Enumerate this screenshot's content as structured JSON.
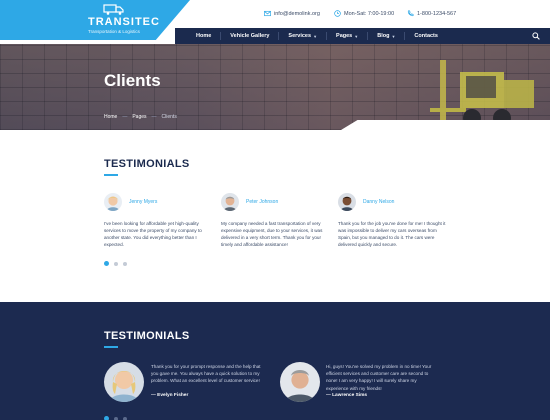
{
  "brand": {
    "name": "TRANSITEC",
    "tagline": "Transportation & Logistics",
    "accent": "#2ea8e6",
    "navy": "#1b2a4e"
  },
  "contacts": {
    "email": "info@demolink.org",
    "hours": "Mon-Sat: 7:00-19:00",
    "phone": "1-800-1234-567"
  },
  "nav": {
    "items": [
      {
        "label": "Home",
        "has_dropdown": false
      },
      {
        "label": "Vehicle Gallery",
        "has_dropdown": false
      },
      {
        "label": "Services",
        "has_dropdown": true
      },
      {
        "label": "Pages",
        "has_dropdown": true
      },
      {
        "label": "Blog",
        "has_dropdown": true
      },
      {
        "label": "Contacts",
        "has_dropdown": false
      }
    ],
    "search_icon": "search-icon"
  },
  "hero": {
    "title": "Clients",
    "breadcrumb": [
      "Home",
      "Pages",
      "Clients"
    ]
  },
  "testimonials_light": {
    "title": "TESTIMONIALS",
    "items": [
      {
        "name": "Jenny Myers",
        "text": "I've been looking for affordable yet high-quality services to move the property of my company to another state. You did everything better than I expected."
      },
      {
        "name": "Peter Johnson",
        "text": "My company needed a fast transportation of very expensive equipment, due to your services, it was delivered in a very short term. Thank you for your timely and affordable assistance!"
      },
      {
        "name": "Danny Nelson",
        "text": "Thank you for the job you've done for me! I thought it was impossible to deliver my cars overseas from Spain, but you managed to do it. The cars were delivered quickly and secure."
      }
    ],
    "pager": {
      "count": 3,
      "active": 1
    }
  },
  "testimonials_dark": {
    "title": "TESTIMONIALS",
    "items": [
      {
        "author": "— Evelyn Fisher",
        "text": "Thank you for your prompt response and the help that you gave me. You always have a quick solution to my problem. What an excellent level of customer service!"
      },
      {
        "author": "— Lawrence Sims",
        "text": "Hi, guys! You've solved my problem in no time! Your efficient services and customer care are second to none! I am very happy! I will surely share my experience with my friends!"
      }
    ]
  }
}
